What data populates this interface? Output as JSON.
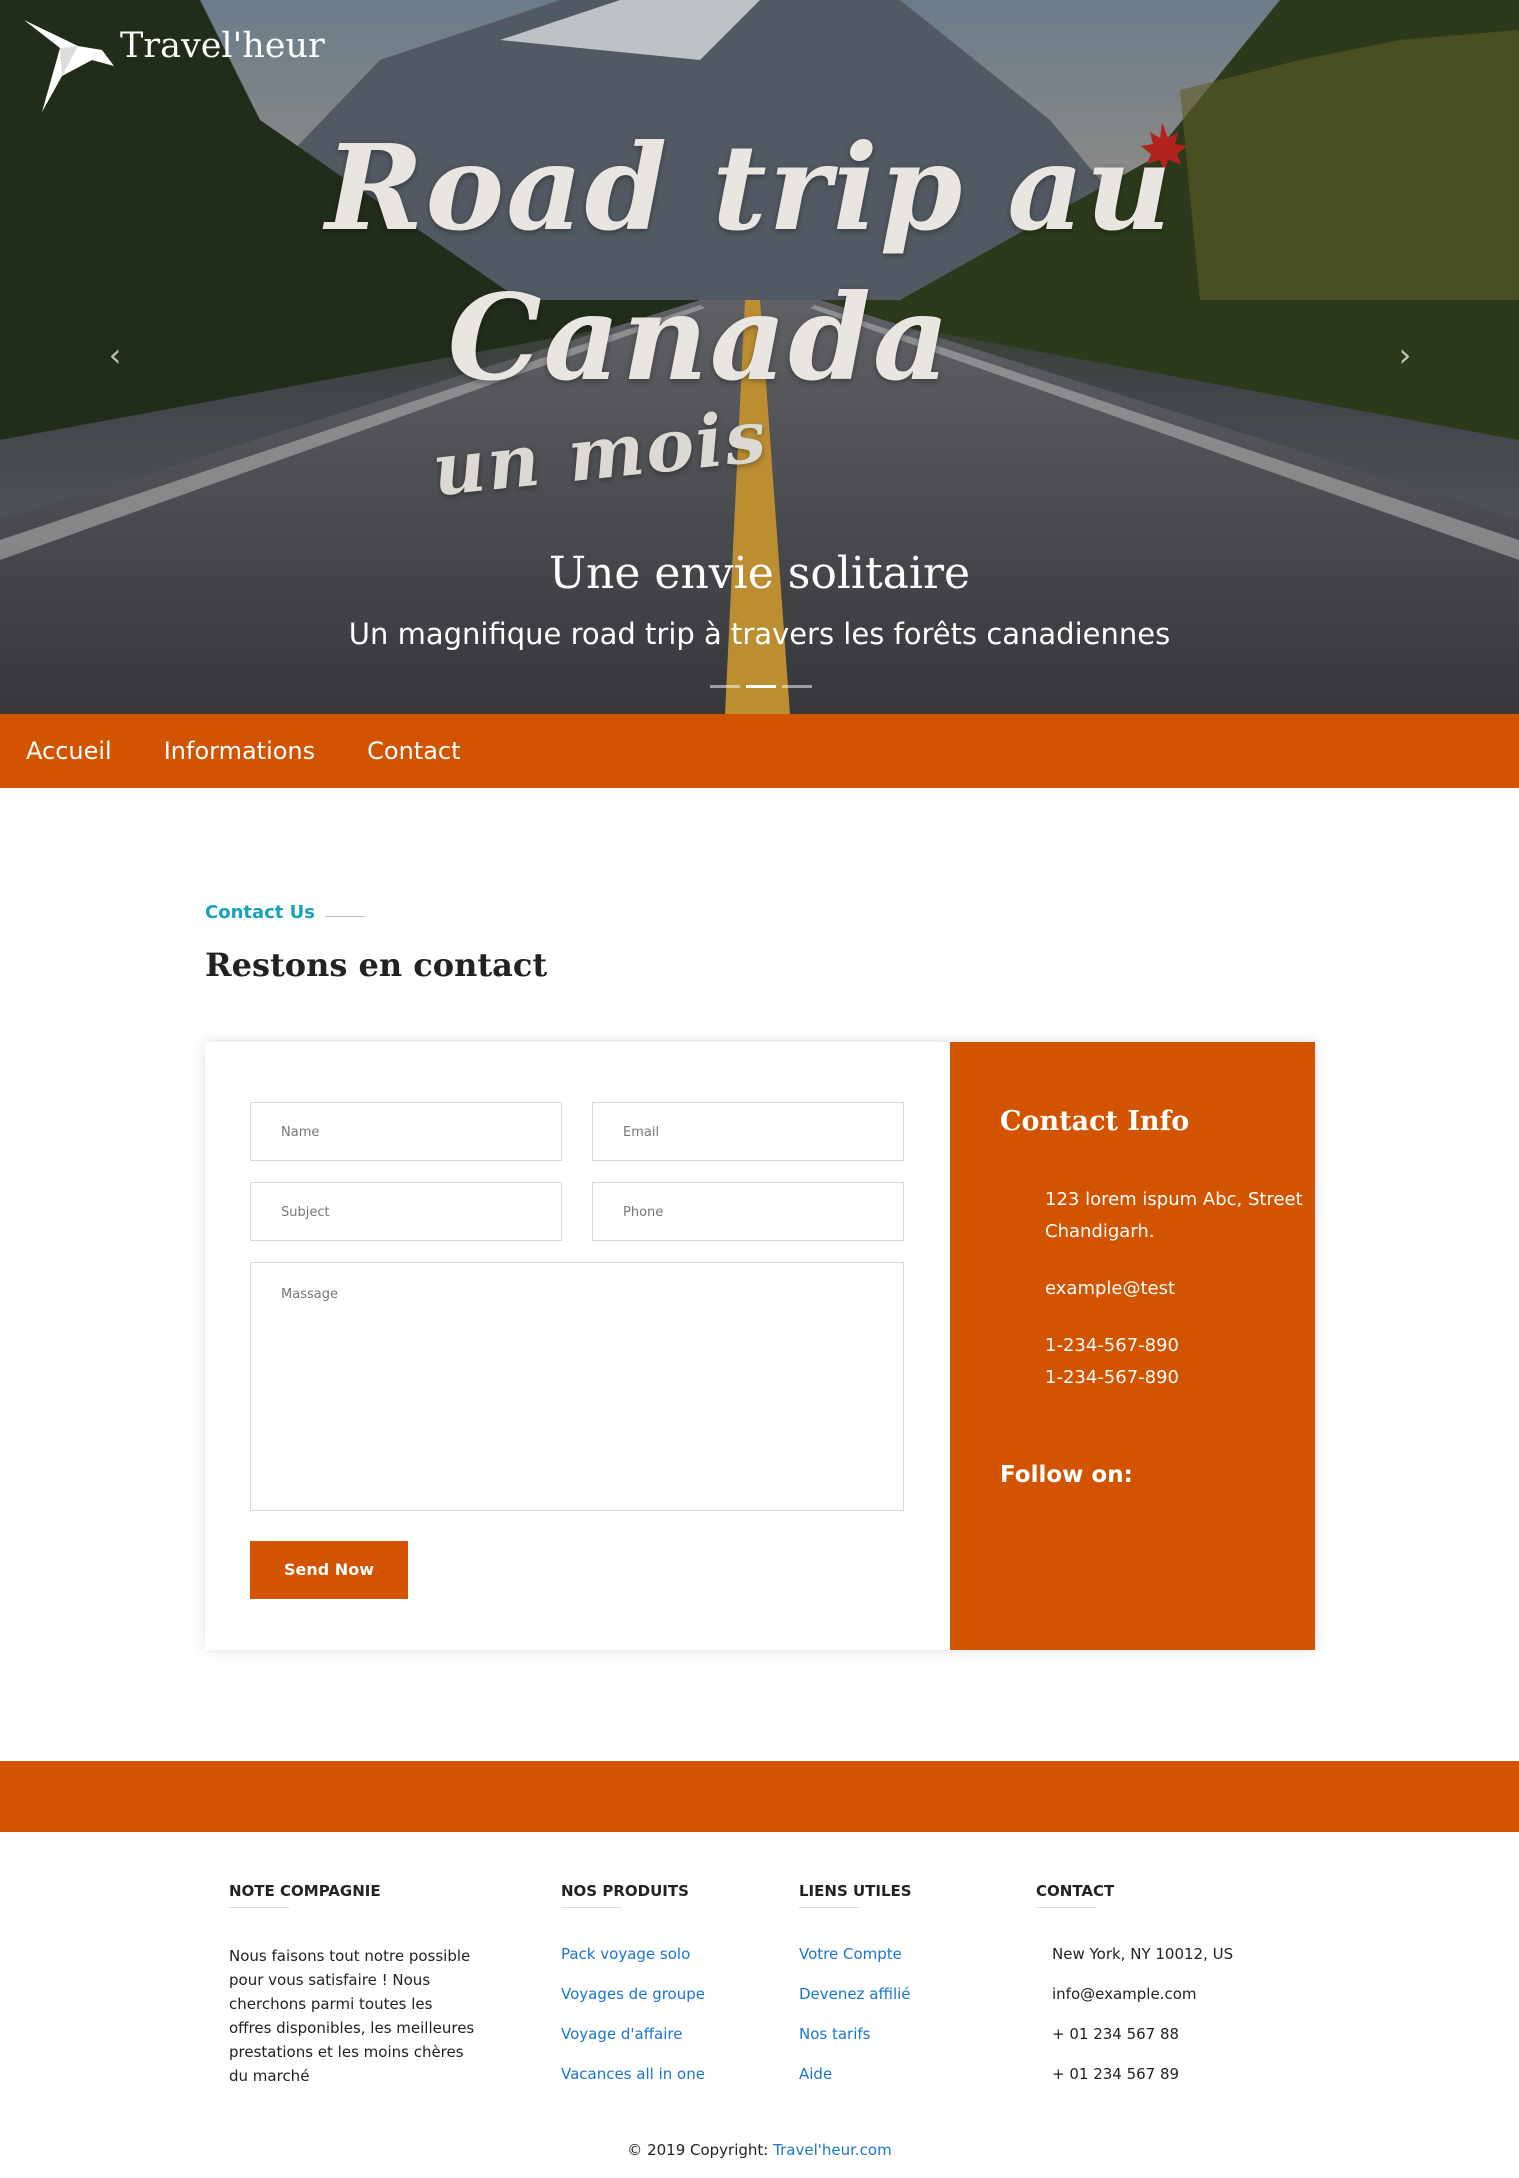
{
  "brand": {
    "name": "Travel'heur",
    "logo_icon": "origami-bird-icon"
  },
  "hero": {
    "image_text_line1": "Road trip au",
    "image_text_line2": "Canada",
    "image_text_line3": "un mois",
    "caption_title": "Une envie solitaire",
    "caption_subtitle": "Un magnifique road trip à travers les forêts canadiennes",
    "slides": 3,
    "active_slide": 1
  },
  "nav": {
    "items": [
      "Accueil",
      "Informations",
      "Contact"
    ]
  },
  "contact": {
    "eyebrow": "Contact Us",
    "title": "Restons en contact",
    "form": {
      "name_placeholder": "Name",
      "email_placeholder": "Email",
      "subject_placeholder": "Subject",
      "phone_placeholder": "Phone",
      "message_placeholder": "Massage",
      "send_label": "Send Now"
    },
    "info": {
      "title": "Contact Info",
      "address_line1": "123 lorem ispum Abc, Street",
      "address_line2": "Chandigarh.",
      "email": "example@test",
      "phone1": "1-234-567-890",
      "phone2": "1-234-567-890",
      "follow_label": "Follow on:"
    }
  },
  "footer": {
    "company": {
      "heading": "NOTE COMPAGNIE",
      "text": "Nous faisons tout notre possible pour vous satisfaire ! Nous cherchons parmi toutes les offres disponibles, les meilleures prestations et les moins chères du marché"
    },
    "products": {
      "heading": "NOS PRODUITS",
      "links": [
        "Pack voyage solo",
        "Voyages de groupe",
        "Voyage d'affaire",
        "Vacances all in one"
      ]
    },
    "useful": {
      "heading": "LIENS UTILES",
      "links": [
        "Votre Compte",
        "Devenez affilié",
        "Nos tarifs",
        "Aide"
      ]
    },
    "contact": {
      "heading": "CONTACT",
      "items": [
        "New York, NY 10012, US",
        "info@example.com",
        "+ 01 234 567 88",
        "+ 01 234 567 89"
      ]
    },
    "copyright_prefix": "© 2019 Copyright:",
    "copyright_link": "Travel'heur.com"
  },
  "colors": {
    "accent": "#d35400",
    "eyebrow": "#17a2b8",
    "link": "#1976d2"
  }
}
